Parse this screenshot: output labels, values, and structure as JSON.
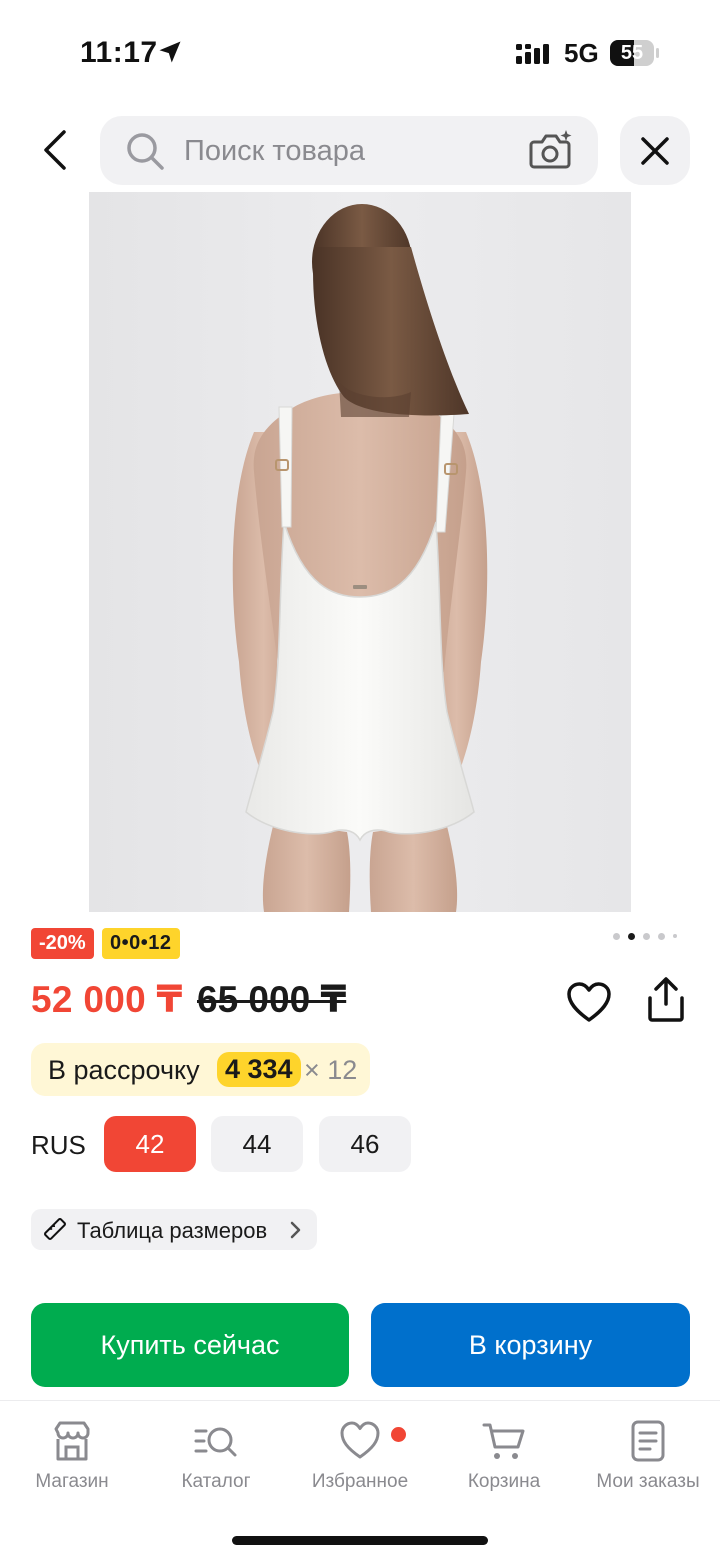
{
  "status_bar": {
    "time": "11:17",
    "network": "5G",
    "battery": "55",
    "battery_level": 0.55
  },
  "search": {
    "placeholder": "Поиск товара"
  },
  "product": {
    "image_alt": "Белый слитный купальник, вид сзади",
    "image_count": 5,
    "active_image_index": 1,
    "discount_badge": "-20%",
    "installment_badge": "0•0•12",
    "price": "52 000 ₸",
    "old_price": "65 000 ₸"
  },
  "installment": {
    "label": "В рассрочку",
    "amount": "4 334",
    "multiplier": "× 12"
  },
  "sizes": {
    "system": "RUS",
    "options": [
      "42",
      "44",
      "46"
    ],
    "selected": "42"
  },
  "size_table": {
    "label": "Таблица размеров"
  },
  "actions": {
    "buy_now": "Купить сейчас",
    "add_to_cart": "В корзину"
  },
  "tabbar": {
    "items": [
      {
        "label": "Магазин",
        "icon": "store-icon"
      },
      {
        "label": "Каталог",
        "icon": "catalog-search-icon"
      },
      {
        "label": "Избранное",
        "icon": "heart-icon"
      },
      {
        "label": "Корзина",
        "icon": "cart-icon"
      },
      {
        "label": "Мои заказы",
        "icon": "orders-icon"
      }
    ]
  },
  "colors": {
    "accent_red": "#f14635",
    "buy_green": "#00ac4f",
    "cart_blue": "#0070cc",
    "badge_yellow": "#fed42b"
  }
}
